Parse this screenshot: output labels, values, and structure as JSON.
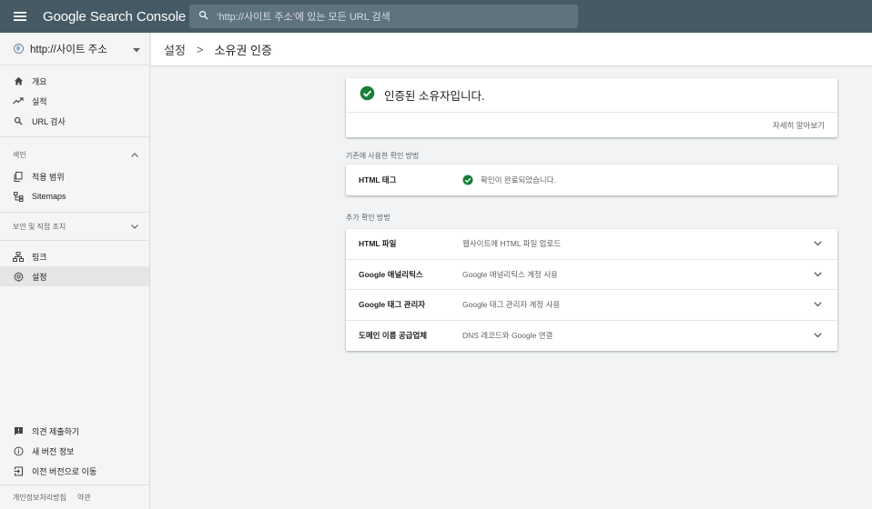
{
  "app": {
    "title": "Google Search Console"
  },
  "search": {
    "placeholder": "‘http://사이트 주소’에 있는 모든 URL 검색"
  },
  "property": {
    "label": "http://사이트 주소"
  },
  "sidebar": {
    "main_items": [
      {
        "label": "개요",
        "icon": "home-icon"
      },
      {
        "label": "실적",
        "icon": "trending-icon"
      },
      {
        "label": "URL 검사",
        "icon": "search-icon"
      }
    ],
    "index_section": {
      "header": "색인",
      "items": [
        {
          "label": "적용 범위",
          "icon": "coverage-icon"
        },
        {
          "label": "Sitemaps",
          "icon": "sitemap-icon"
        }
      ]
    },
    "security_section": {
      "header": "보안 및 직접 조치"
    },
    "other_items": [
      {
        "label": "링크",
        "icon": "links-icon"
      },
      {
        "label": "설정",
        "icon": "settings-icon",
        "active": true
      }
    ],
    "bottom_items": [
      {
        "label": "의견 제출하기",
        "icon": "feedback-icon"
      },
      {
        "label": "새 버전 정보",
        "icon": "info-icon"
      },
      {
        "label": "이전 버전으로 이동",
        "icon": "exit-icon"
      }
    ],
    "footer": {
      "privacy": "개인정보처리방침",
      "terms": "약관"
    }
  },
  "breadcrumb": {
    "parent": "설정",
    "separator": ">",
    "current": "소유권 인증"
  },
  "verified": {
    "text": "인증된 소유자입니다.",
    "learn_more": "자세히 알아보기"
  },
  "existing": {
    "label": "기존에 사용한 확인 방법",
    "method": {
      "name": "HTML 태그",
      "status": "확인이 완료되었습니다."
    }
  },
  "additional": {
    "label": "추가 확인 방법",
    "methods": [
      {
        "name": "HTML 파일",
        "desc": "웹사이트에 HTML 파일 업로드"
      },
      {
        "name": "Google 애널리틱스",
        "desc": "Google 애널리틱스 계정 사용"
      },
      {
        "name": "Google 태그 관리자",
        "desc": "Google 태그 관리자 계정 사용"
      },
      {
        "name": "도메인 이름 공급업체",
        "desc": "DNS 레코드와 Google 연결"
      }
    ]
  },
  "colors": {
    "topbar": "#455a64",
    "check_green": "#188038",
    "active_bg": "#e5e5e5"
  }
}
